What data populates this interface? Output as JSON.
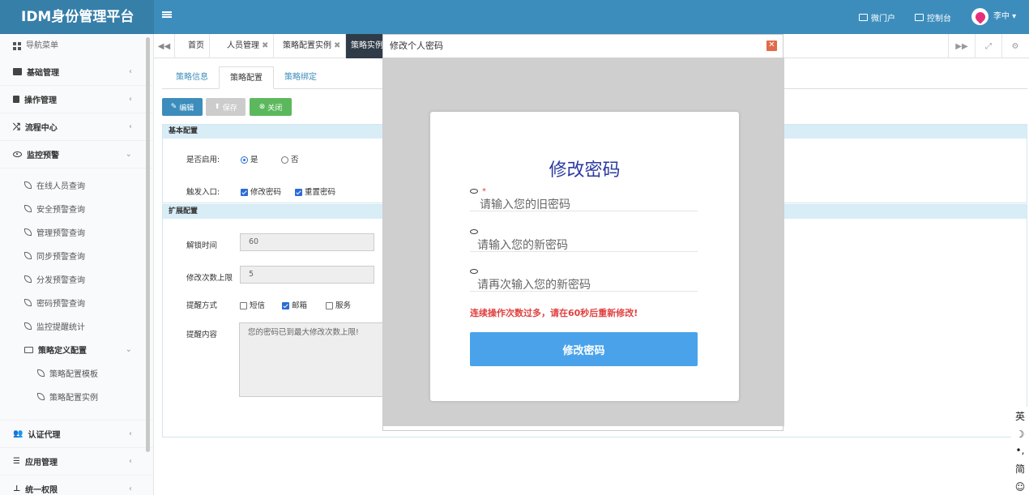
{
  "app": {
    "title": "IDM身份管理平台"
  },
  "topnav": {
    "portal": "微门户",
    "console": "控制台",
    "user": "李中 ▾"
  },
  "sidebar": {
    "title": "导航菜单",
    "items": [
      {
        "label": "基础管理",
        "icon": "id-card-icon"
      },
      {
        "label": "操作管理",
        "icon": "book-icon"
      },
      {
        "label": "流程中心",
        "icon": "shuffle-icon"
      },
      {
        "label": "监控预警",
        "icon": "eye-icon"
      }
    ],
    "monitor_subs": [
      "在线人员查询",
      "安全预警查询",
      "管理预警查询",
      "同步预警查询",
      "分发预警查询",
      "密码预警查询",
      "监控提醒统计"
    ],
    "policy_cfg": "策略定义配置",
    "policy_subs": [
      "策略配置模板",
      "策略配置实例"
    ],
    "bottom_items": [
      {
        "label": "认证代理",
        "icon": "users-icon"
      },
      {
        "label": "应用管理",
        "icon": "list-icon"
      },
      {
        "label": "统一权限",
        "icon": "sitemap-icon"
      }
    ]
  },
  "tabs": [
    {
      "label": "首页",
      "closable": false
    },
    {
      "label": "人员管理",
      "closable": true
    },
    {
      "label": "策略配置实例",
      "closable": true
    },
    {
      "label": "策略实例",
      "closable": false
    }
  ],
  "subtabs": [
    "策略信息",
    "策略配置",
    "策略绑定"
  ],
  "toolbar": {
    "edit": "编辑",
    "save": "保存",
    "close": "关闭"
  },
  "basic": {
    "header": "基本配置",
    "enabled_label": "是否启用:",
    "yes": "是",
    "no": "否",
    "trigger_label": "触发入口:",
    "trigger_opt1": "修改密码",
    "trigger_opt2": "重置密码"
  },
  "ext": {
    "header": "扩展配置",
    "unlock_label": "解锁时间",
    "unlock_value": "60",
    "limit_label": "修改次数上限",
    "limit_value": "5",
    "remind_label": "提醒方式",
    "remind_sms": "短信",
    "remind_mail": "邮箱",
    "remind_service": "服务",
    "content_label": "提醒内容",
    "content_value": "您的密码已到最大修改次数上限!"
  },
  "modal": {
    "title": "修改个人密码",
    "heading": "修改密码",
    "star": "*",
    "old_ph": "请输入您的旧密码",
    "new_ph": "请输入您的新密码",
    "confirm_ph": "请再次输入您的新密码",
    "warning": "连续操作次数过多，请在60秒后重新修改!",
    "submit": "修改密码"
  },
  "ime": [
    "英",
    "☽",
    "•,",
    "简",
    "☺"
  ],
  "colors": {
    "topbar": "#3c8dbc",
    "brand": "#367fa9",
    "accent": "#4aa3ea",
    "warning": "#e04040"
  }
}
